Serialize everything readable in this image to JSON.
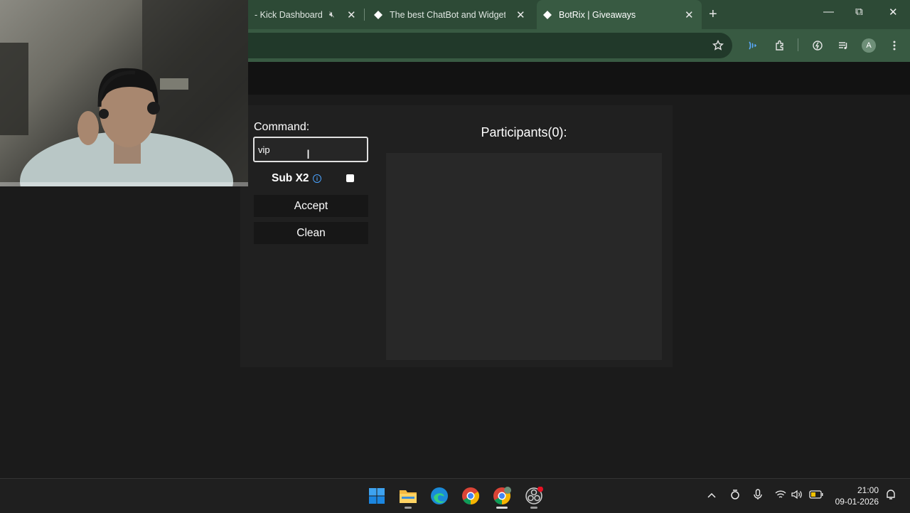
{
  "browser": {
    "tabs": [
      {
        "title": "- Kick Dashboard",
        "muted": true
      },
      {
        "title": "The best ChatBot and Widgets f"
      },
      {
        "title": "BotRix | Giveaways",
        "active": true
      }
    ],
    "new_tab_symbol": "+",
    "window_controls": {
      "minimize": "—",
      "restore": "⧉",
      "close": "✕"
    },
    "profile_initial": "A",
    "icons": [
      "star-icon",
      "voice-icon",
      "extensions-icon",
      "performance-icon",
      "media-control-icon",
      "profile-avatar",
      "menu-icon"
    ]
  },
  "giveaway": {
    "command_label": "Command:",
    "command_value": "vip",
    "sub_label": "Sub X2",
    "sub_checked": false,
    "accept_label": "Accept",
    "clean_label": "Clean",
    "participants_title": "Participants(0):"
  },
  "taskbar": {
    "apps": [
      "windows-start",
      "file-explorer",
      "edge",
      "chrome",
      "chrome-profile",
      "obs"
    ],
    "time": "21:00",
    "date": "09-01-2026"
  },
  "colors": {
    "tabstrip": "#2d4a36",
    "toolbar": "#385a42",
    "page_bg": "#1b1b1b",
    "panel_bg": "#202020",
    "info_blue": "#4aa3ff"
  }
}
